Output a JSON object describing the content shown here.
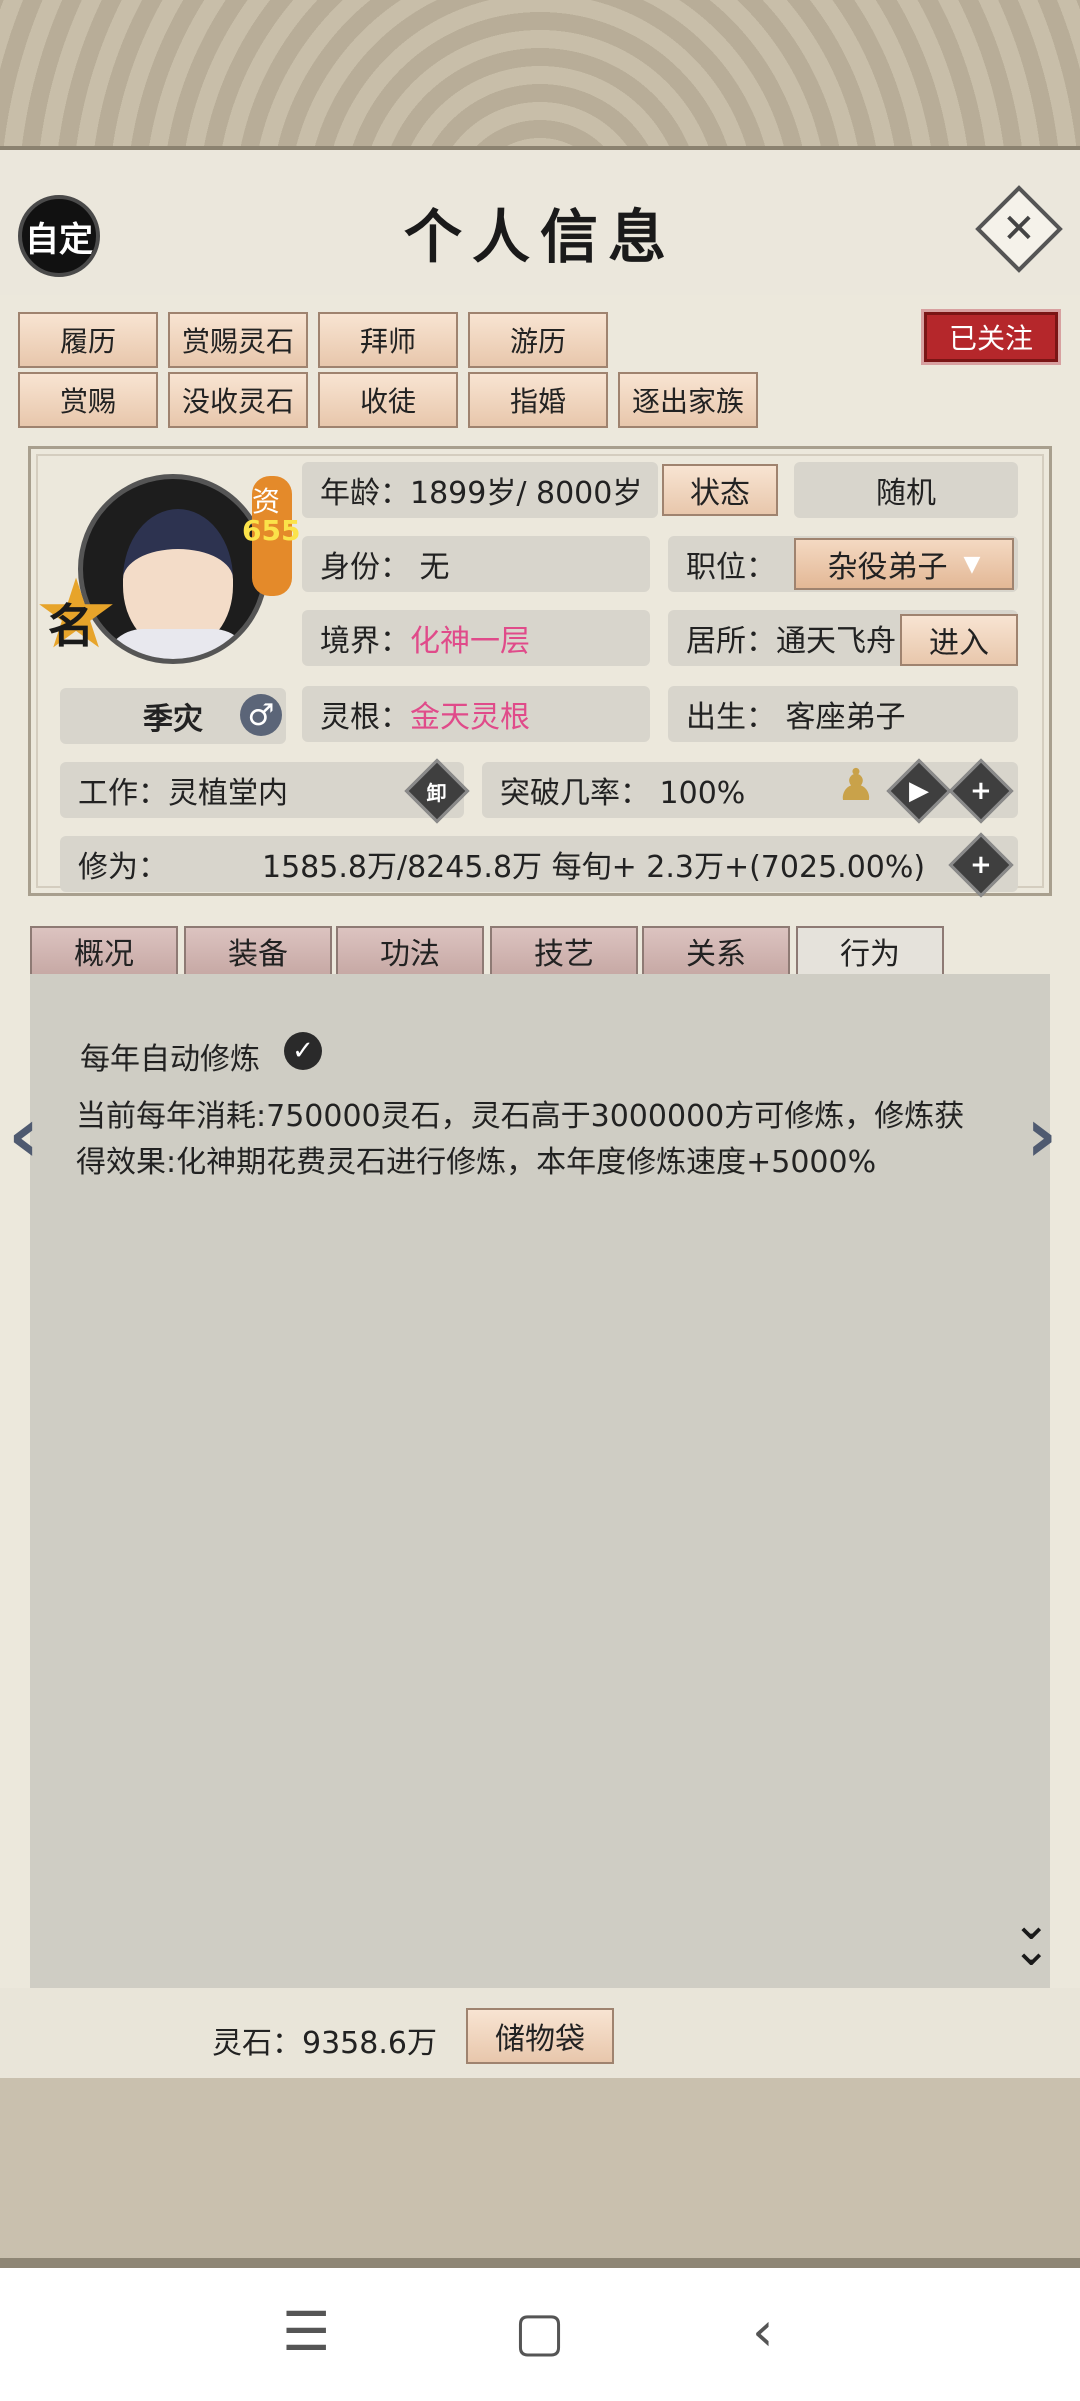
{
  "header": {
    "auto_label": "自定",
    "title": "个人信息",
    "close_glyph": "✕"
  },
  "actions_row1": [
    "履历",
    "赏赐灵石",
    "拜师",
    "游历"
  ],
  "actions_row2": [
    "赏赐",
    "没收灵石",
    "收徒",
    "指婚",
    "逐出家族"
  ],
  "follow_label": "已关注",
  "profile": {
    "name": "季灾",
    "star_label": "名",
    "aptitude_label": "资",
    "aptitude_value": "655",
    "age_text": "年龄：1899岁/ 8000岁",
    "status_btn": "状态",
    "random_btn": "随机",
    "identity": "身份：  无",
    "position_label": "职位：",
    "position_value": "杂役弟子",
    "realm_label": "境界：",
    "realm_value": "化神一层",
    "residence": "居所：通天飞舟",
    "enter_btn": "进入",
    "root_label": "灵根：",
    "root_value": "金天灵根",
    "birth": "出生：  客座弟子",
    "work": "工作：灵植堂内",
    "unload_glyph": "卸",
    "breakthrough": "突破几率：  100%",
    "cultivation_label": "修为：",
    "cultivation_value": "1585.8万/8245.8万  每旬+   2.3万+(7025.00%)"
  },
  "tabs": [
    "概况",
    "装备",
    "功法",
    "技艺",
    "关系",
    "行为"
  ],
  "active_tab": "行为",
  "behavior": {
    "auto_cultivate": "每年自动修炼",
    "description": "当前每年消耗:750000灵石，灵石高于3000000方可修炼，修炼获得效果:化神期花费灵石进行修炼，本年度修炼速度+5000%"
  },
  "footer": {
    "spirit_stone": "灵石：9358.6万",
    "bag_btn": "储物袋"
  }
}
